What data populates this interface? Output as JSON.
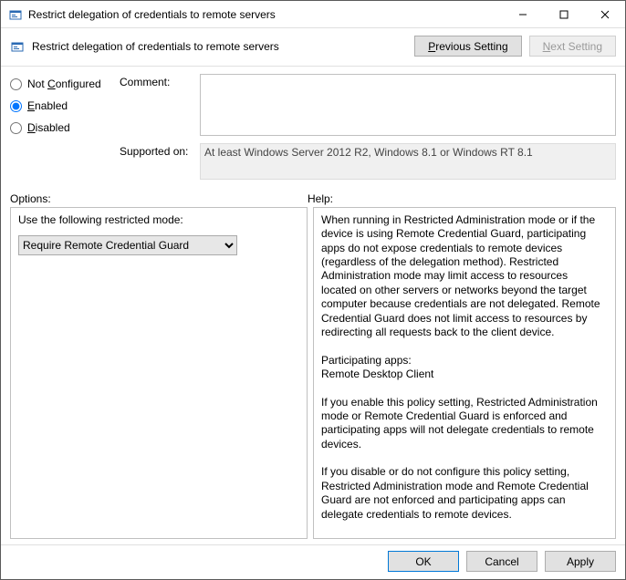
{
  "window": {
    "title": "Restrict delegation of credentials to remote servers"
  },
  "subheader": {
    "title": "Restrict delegation of credentials to remote servers"
  },
  "nav": {
    "previous": "Previous Setting",
    "next": "Next Setting"
  },
  "state": {
    "not_configured": "Not Configured",
    "enabled": "Enabled",
    "disabled": "Disabled",
    "selected": "enabled"
  },
  "labels": {
    "comment": "Comment:",
    "supported_on": "Supported on:",
    "options": "Options:",
    "help": "Help:"
  },
  "comment_value": "",
  "supported_on_text": "At least Windows Server 2012 R2, Windows 8.1 or Windows RT 8.1",
  "options": {
    "mode_label": "Use the following restricted mode:",
    "mode_value": "Require Remote Credential Guard"
  },
  "help_text": "When running in Restricted Administration mode or if the device is using Remote Credential Guard, participating apps do not expose credentials to remote devices (regardless of the delegation method). Restricted Administration mode may limit access to resources located on other servers or networks beyond the target computer because credentials are not delegated. Remote Credential Guard does not limit access to resources by redirecting all requests back to the client device.\n\nParticipating apps:\nRemote Desktop Client\n\nIf you enable this policy setting, Restricted Administration mode or Remote Credential Guard is enforced and participating apps will not delegate credentials to remote devices.\n\nIf you disable or do not configure this policy setting, Restricted Administration mode and Remote Credential Guard are not enforced and participating apps can delegate credentials to remote devices.",
  "footer": {
    "ok": "OK",
    "cancel": "Cancel",
    "apply": "Apply"
  }
}
